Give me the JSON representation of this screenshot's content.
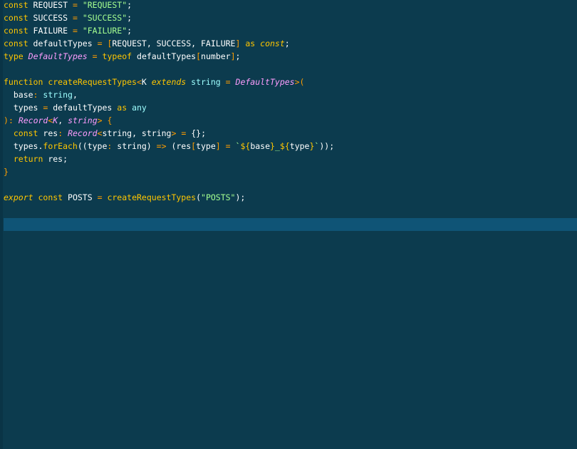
{
  "editor": {
    "lines": [
      [
        [
          "k",
          "const"
        ],
        [
          "p",
          " REQUEST "
        ],
        [
          "op",
          "="
        ],
        [
          "p",
          " "
        ],
        [
          "s",
          "\"REQUEST\""
        ],
        [
          "p",
          ";"
        ]
      ],
      [
        [
          "k",
          "const"
        ],
        [
          "p",
          " SUCCESS "
        ],
        [
          "op",
          "="
        ],
        [
          "p",
          " "
        ],
        [
          "s",
          "\"SUCCESS\""
        ],
        [
          "p",
          ";"
        ]
      ],
      [
        [
          "k",
          "const"
        ],
        [
          "p",
          " FAILURE "
        ],
        [
          "op",
          "="
        ],
        [
          "p",
          " "
        ],
        [
          "s",
          "\"FAILURE\""
        ],
        [
          "p",
          ";"
        ]
      ],
      [
        [
          "k",
          "const"
        ],
        [
          "p",
          " defaultTypes "
        ],
        [
          "op",
          "="
        ],
        [
          "p",
          " "
        ],
        [
          "op",
          "["
        ],
        [
          "p",
          "REQUEST, SUCCESS, FAILURE"
        ],
        [
          "op",
          "]"
        ],
        [
          "p",
          " "
        ],
        [
          "k",
          "as"
        ],
        [
          "p",
          " "
        ],
        [
          "ki",
          "const"
        ],
        [
          "p",
          ";"
        ]
      ],
      [
        [
          "k",
          "type"
        ],
        [
          "p",
          " "
        ],
        [
          "t",
          "DefaultTypes"
        ],
        [
          "p",
          " "
        ],
        [
          "op",
          "="
        ],
        [
          "p",
          " "
        ],
        [
          "k",
          "typeof"
        ],
        [
          "p",
          " defaultTypes"
        ],
        [
          "op",
          "["
        ],
        [
          "p",
          "number"
        ],
        [
          "op",
          "]"
        ],
        [
          "p",
          ";"
        ]
      ],
      [],
      [
        [
          "k",
          "function"
        ],
        [
          "p",
          " "
        ],
        [
          "fn",
          "createRequestTypes"
        ],
        [
          "op",
          "<"
        ],
        [
          "p",
          "K "
        ],
        [
          "ki",
          "extends"
        ],
        [
          "p",
          " "
        ],
        [
          "prm",
          "string"
        ],
        [
          "p",
          " "
        ],
        [
          "op",
          "="
        ],
        [
          "p",
          " "
        ],
        [
          "t",
          "DefaultTypes"
        ],
        [
          "op",
          ">"
        ],
        [
          "op",
          "("
        ]
      ],
      [
        [
          "p",
          "  base"
        ],
        [
          "op",
          ":"
        ],
        [
          "p",
          " "
        ],
        [
          "prm",
          "string"
        ],
        [
          "p",
          ","
        ]
      ],
      [
        [
          "p",
          "  types "
        ],
        [
          "op",
          "="
        ],
        [
          "p",
          " defaultTypes "
        ],
        [
          "k",
          "as"
        ],
        [
          "p",
          " "
        ],
        [
          "prm",
          "any"
        ]
      ],
      [
        [
          "op",
          ")"
        ],
        [
          "op",
          ":"
        ],
        [
          "p",
          " "
        ],
        [
          "t",
          "Record"
        ],
        [
          "op",
          "<"
        ],
        [
          "t",
          "K"
        ],
        [
          "p",
          ", "
        ],
        [
          "t",
          "string"
        ],
        [
          "op",
          ">"
        ],
        [
          "p",
          " "
        ],
        [
          "op",
          "{"
        ]
      ],
      [
        [
          "p",
          "  "
        ],
        [
          "k",
          "const"
        ],
        [
          "p",
          " res"
        ],
        [
          "op",
          ":"
        ],
        [
          "p",
          " "
        ],
        [
          "t",
          "Record"
        ],
        [
          "op",
          "<"
        ],
        [
          "p",
          "string, string"
        ],
        [
          "op",
          ">"
        ],
        [
          "p",
          " "
        ],
        [
          "op",
          "="
        ],
        [
          "p",
          " {};"
        ]
      ],
      [
        [
          "p",
          "  types."
        ],
        [
          "fn",
          "forEach"
        ],
        [
          "p",
          "((type"
        ],
        [
          "op",
          ":"
        ],
        [
          "p",
          " string) "
        ],
        [
          "op",
          "=>"
        ],
        [
          "p",
          " (res"
        ],
        [
          "op",
          "["
        ],
        [
          "p",
          "type"
        ],
        [
          "op",
          "]"
        ],
        [
          "p",
          " "
        ],
        [
          "op",
          "="
        ],
        [
          "p",
          " "
        ],
        [
          "s",
          "`"
        ],
        [
          "k",
          "${"
        ],
        [
          "p",
          "base"
        ],
        [
          "k",
          "}"
        ],
        [
          "s",
          "_"
        ],
        [
          "k",
          "${"
        ],
        [
          "p",
          "type"
        ],
        [
          "k",
          "}"
        ],
        [
          "s",
          "`"
        ],
        [
          "p",
          "));"
        ]
      ],
      [
        [
          "p",
          "  "
        ],
        [
          "k",
          "return"
        ],
        [
          "p",
          " res;"
        ]
      ],
      [
        [
          "op",
          "}"
        ]
      ],
      [],
      [
        [
          "ki",
          "export"
        ],
        [
          "p",
          " "
        ],
        [
          "k",
          "const"
        ],
        [
          "p",
          " POSTS "
        ],
        [
          "op",
          "="
        ],
        [
          "p",
          " "
        ],
        [
          "fn",
          "createRequestTypes"
        ],
        [
          "p",
          "("
        ],
        [
          "s",
          "\"POSTS\""
        ],
        [
          "p",
          ");"
        ]
      ],
      [],
      []
    ],
    "active_line": 17,
    "colors": {
      "background": "#0c3b4e",
      "active_line": "#0f5476",
      "keyword": "#ffc600",
      "string": "#a5ff90",
      "type": "#ff9dff",
      "aqua": "#9effff",
      "operator": "#ff9d00"
    }
  }
}
